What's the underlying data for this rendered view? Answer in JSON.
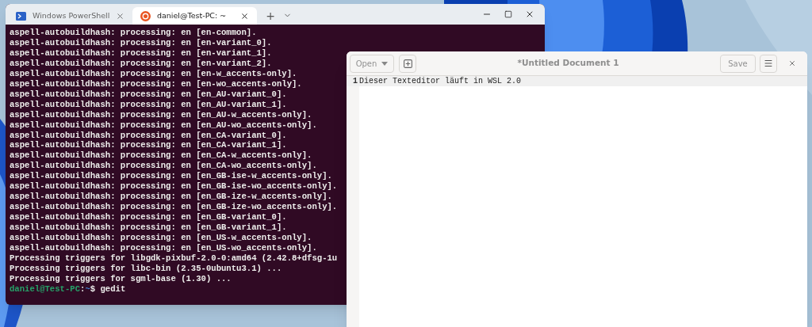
{
  "terminal": {
    "tabs": [
      {
        "label": "Windows PowerShell",
        "kind": "powershell",
        "selected": false
      },
      {
        "label": "daniel@Test-PC: ~",
        "kind": "ubuntu",
        "selected": true
      }
    ],
    "new_tab": "+",
    "lines": [
      "aspell-autobuildhash: processing: en [en-common].",
      "aspell-autobuildhash: processing: en [en-variant_0].",
      "aspell-autobuildhash: processing: en [en-variant_1].",
      "aspell-autobuildhash: processing: en [en-variant_2].",
      "aspell-autobuildhash: processing: en [en-w_accents-only].",
      "aspell-autobuildhash: processing: en [en-wo_accents-only].",
      "aspell-autobuildhash: processing: en [en_AU-variant_0].",
      "aspell-autobuildhash: processing: en [en_AU-variant_1].",
      "aspell-autobuildhash: processing: en [en_AU-w_accents-only].",
      "aspell-autobuildhash: processing: en [en_AU-wo_accents-only].",
      "aspell-autobuildhash: processing: en [en_CA-variant_0].",
      "aspell-autobuildhash: processing: en [en_CA-variant_1].",
      "aspell-autobuildhash: processing: en [en_CA-w_accents-only].",
      "aspell-autobuildhash: processing: en [en_CA-wo_accents-only].",
      "aspell-autobuildhash: processing: en [en_GB-ise-w_accents-only].",
      "aspell-autobuildhash: processing: en [en_GB-ise-wo_accents-only].",
      "aspell-autobuildhash: processing: en [en_GB-ize-w_accents-only].",
      "aspell-autobuildhash: processing: en [en_GB-ize-wo_accents-only].",
      "aspell-autobuildhash: processing: en [en_GB-variant_0].",
      "aspell-autobuildhash: processing: en [en_GB-variant_1].",
      "aspell-autobuildhash: processing: en [en_US-w_accents-only].",
      "aspell-autobuildhash: processing: en [en_US-wo_accents-only].",
      "Processing triggers for libgdk-pixbuf-2.0-0:amd64 (2.42.8+dfsg-1u",
      "Processing triggers for libc-bin (2.35-0ubuntu3.1) ...",
      "Processing triggers for sgml-base (1.30) ..."
    ],
    "prompt": {
      "user_host": "daniel@Test-PC",
      "separator": ":",
      "path": "~",
      "command": "$ gedit"
    }
  },
  "editor": {
    "open_button": "Open",
    "title": "*Untitled Document 1",
    "save_button": "Save",
    "lines": [
      {
        "number": "1",
        "text": "Dieser Texteditor läuft in WSL 2.0",
        "current": true
      }
    ]
  }
}
